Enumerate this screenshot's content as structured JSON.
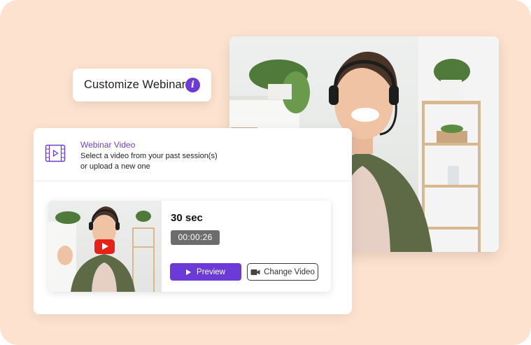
{
  "chip": {
    "label": "Customize Webinar",
    "icon": "info-icon"
  },
  "panel": {
    "title": "Webinar Video",
    "description_line1": "Select a video from your past session(s)",
    "description_line2": "or upload a new one",
    "icon": "video-film-icon"
  },
  "video": {
    "duration": "30 sec",
    "timecode": "00:00:26",
    "preview_label": "Preview",
    "change_label": "Change Video"
  },
  "colors": {
    "background": "#fde3cf",
    "accent": "#6c3ad6",
    "youtube_red": "#e62117"
  }
}
